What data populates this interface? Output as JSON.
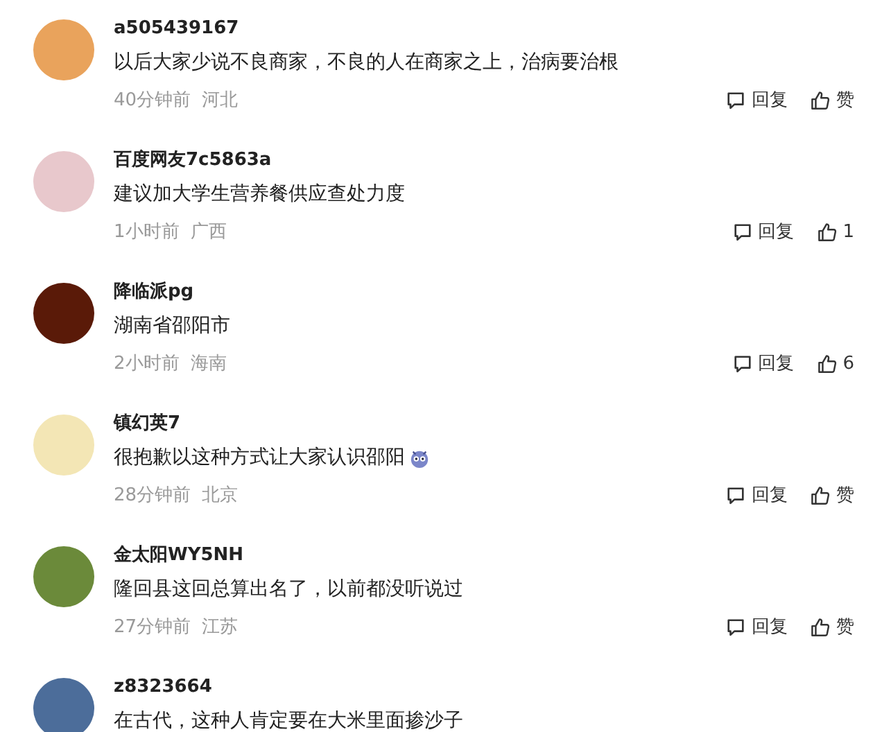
{
  "comments": [
    {
      "username": "a505439167",
      "text": "以后大家少说不良商家，不良的人在商家之上，治病要治根",
      "emoji": false,
      "time": "40分钟前",
      "location": "河北",
      "reply_label": "回复",
      "like_label": "赞"
    },
    {
      "username": "百度网友7c5863a",
      "text": "建议加大学生营养餐供应查处力度",
      "emoji": false,
      "time": "1小时前",
      "location": "广西",
      "reply_label": "回复",
      "like_label": "1"
    },
    {
      "username": "降临派pg",
      "text": "湖南省邵阳市",
      "emoji": false,
      "time": "2小时前",
      "location": "海南",
      "reply_label": "回复",
      "like_label": "6"
    },
    {
      "username": "镇幻英7",
      "text": "很抱歉以这种方式让大家认识邵阳",
      "emoji": true,
      "time": "28分钟前",
      "location": "北京",
      "reply_label": "回复",
      "like_label": "赞"
    },
    {
      "username": "金太阳WY5NH",
      "text": "隆回县这回总算出名了，以前都没听说过",
      "emoji": false,
      "time": "27分钟前",
      "location": "江苏",
      "reply_label": "回复",
      "like_label": "赞"
    },
    {
      "username": "z8323664",
      "text": "在古代，这种人肯定要在大米里面掺沙子",
      "emoji": false
    }
  ]
}
